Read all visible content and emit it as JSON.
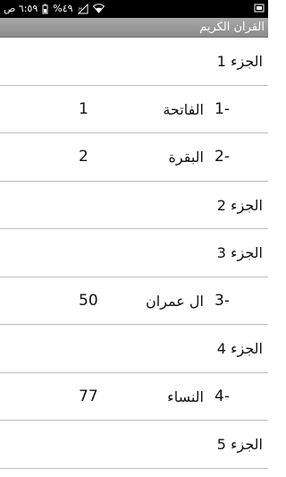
{
  "status_bar": {
    "time": "٦:٥٩ ص",
    "battery": "%٤٩",
    "icons": [
      "wifi-icon",
      "signal-icon",
      "battery-icon",
      "sim-icon"
    ]
  },
  "app": {
    "title": "القران الكريم"
  },
  "rows": [
    {
      "type": "juz",
      "label": "الجزء 1"
    },
    {
      "type": "sura",
      "number": "1-",
      "name": "الفاتحة",
      "page": "1"
    },
    {
      "type": "sura",
      "number": "2-",
      "name": "البقرة",
      "page": "2"
    },
    {
      "type": "juz",
      "label": "الجزء 2"
    },
    {
      "type": "juz",
      "label": "الجزء 3"
    },
    {
      "type": "sura",
      "number": "3-",
      "name": "ال عمران",
      "page": "50"
    },
    {
      "type": "juz",
      "label": "الجزء 4"
    },
    {
      "type": "sura",
      "number": "4-",
      "name": "النساء",
      "page": "77"
    },
    {
      "type": "juz",
      "label": "الجزء 5"
    }
  ]
}
